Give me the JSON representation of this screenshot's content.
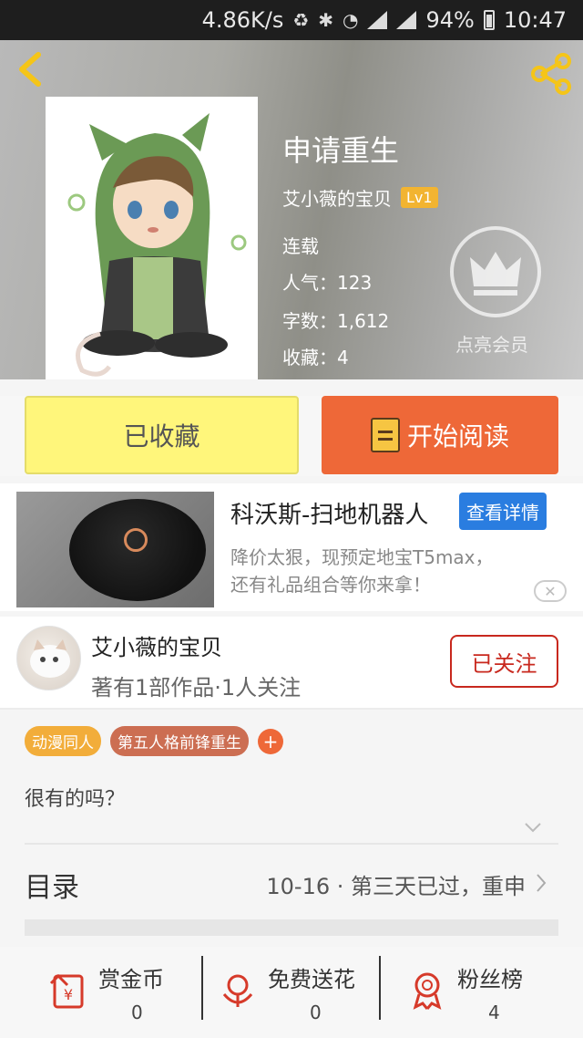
{
  "status_bar": {
    "speed": "4.86K/s",
    "battery": "94%",
    "time": "10:47"
  },
  "book": {
    "title": "申请重生",
    "author": "艾小薇的宝贝",
    "level": "Lv1",
    "status": "连载",
    "popularity": "人气：123",
    "word_count": "字数：1,612",
    "favorites": "收藏：4",
    "vip_label": "点亮会员"
  },
  "actions": {
    "collected": "已收藏",
    "start_reading": "开始阅读"
  },
  "ad": {
    "title": "科沃斯-扫地机器人",
    "detail_button": "查看详情",
    "desc_line1": "降价太狠，现预定地宝T5max，",
    "desc_line2": "还有礼品组合等你来拿！",
    "close": "✕"
  },
  "author_card": {
    "name": "艾小薇的宝贝",
    "stats": "著有1部作品·1人关注",
    "follow": "已关注"
  },
  "tags": [
    "动漫同人",
    "第五人格前锋重生"
  ],
  "tag_add": "+",
  "description": "很有的吗？",
  "catalog": {
    "label": "目录",
    "latest": "10-16 · 第三天已过，重申"
  },
  "bottom_stats": [
    {
      "label": "赏金币",
      "value": "0"
    },
    {
      "label": "免费送花",
      "value": "0"
    },
    {
      "label": "粉丝榜",
      "value": "4"
    }
  ],
  "colors": {
    "primary_orange": "#ee6838",
    "collected_yellow": "#fff67b",
    "level_badge": "#f2b431",
    "follow_red": "#c8281e",
    "ad_blue": "#2a7de0"
  }
}
